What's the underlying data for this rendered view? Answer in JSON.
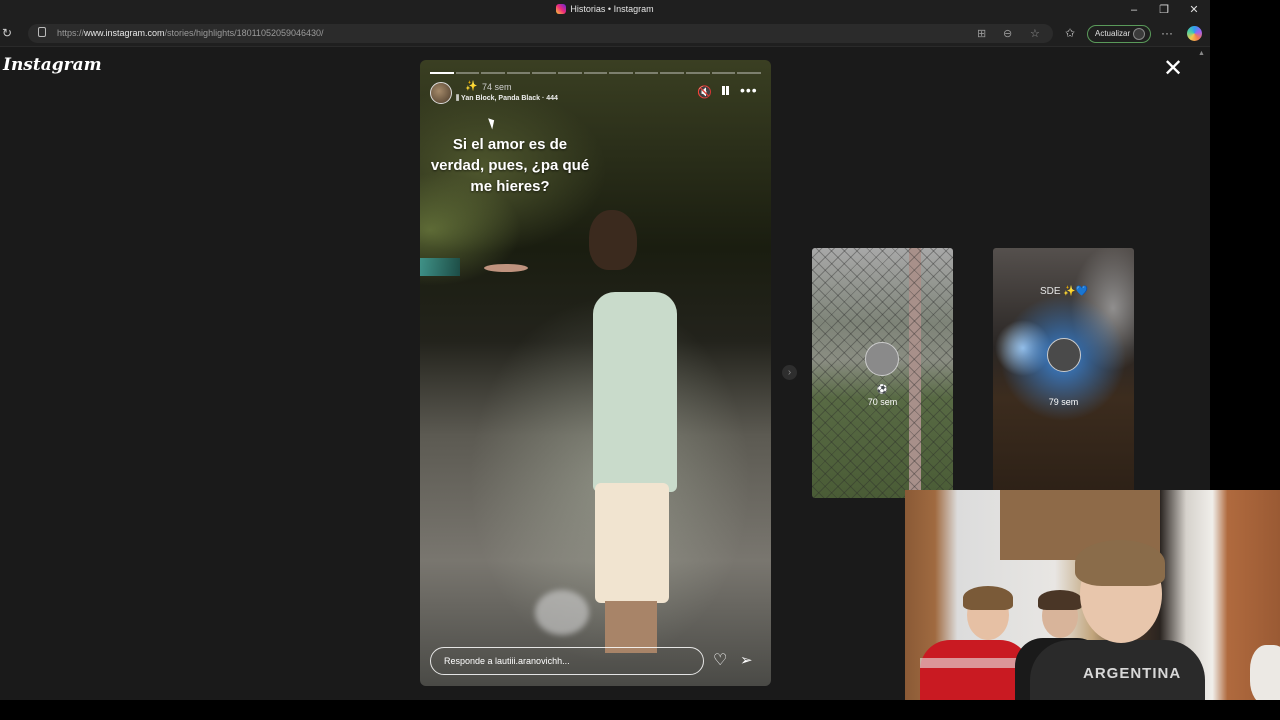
{
  "browser": {
    "tab_title": "Historias • Instagram",
    "url_prefix": "https://",
    "url_domain": "www.instagram.com",
    "url_path": "/stories/highlights/18011052059046430/",
    "update_label": "Actualizar",
    "window_controls": [
      "minimize-icon",
      "restore-icon",
      "close-icon"
    ]
  },
  "instagram": {
    "logo": "Instagram",
    "close_icon": "close-icon"
  },
  "story": {
    "segments": 13,
    "sparkle": "✨",
    "time_ago": "74 sem",
    "music": "Yan Block, Panda Black · 444",
    "text": "Si el amor es de verdad, pues, ¿pa qué me hieres?",
    "reply_placeholder": "Responde a lautiii.aranovichh...",
    "icons": [
      "muted-speaker-icon",
      "pause-icon",
      "more-icon",
      "heart-icon",
      "send-icon"
    ]
  },
  "highlights": [
    {
      "emoji": "⚽",
      "time_ago": "70 sem"
    },
    {
      "caption": "SDE ✨",
      "caption_heart": "💙",
      "time_ago": "79 sem"
    }
  ],
  "webcam": {
    "shirt_text": "ARGENTINA"
  }
}
